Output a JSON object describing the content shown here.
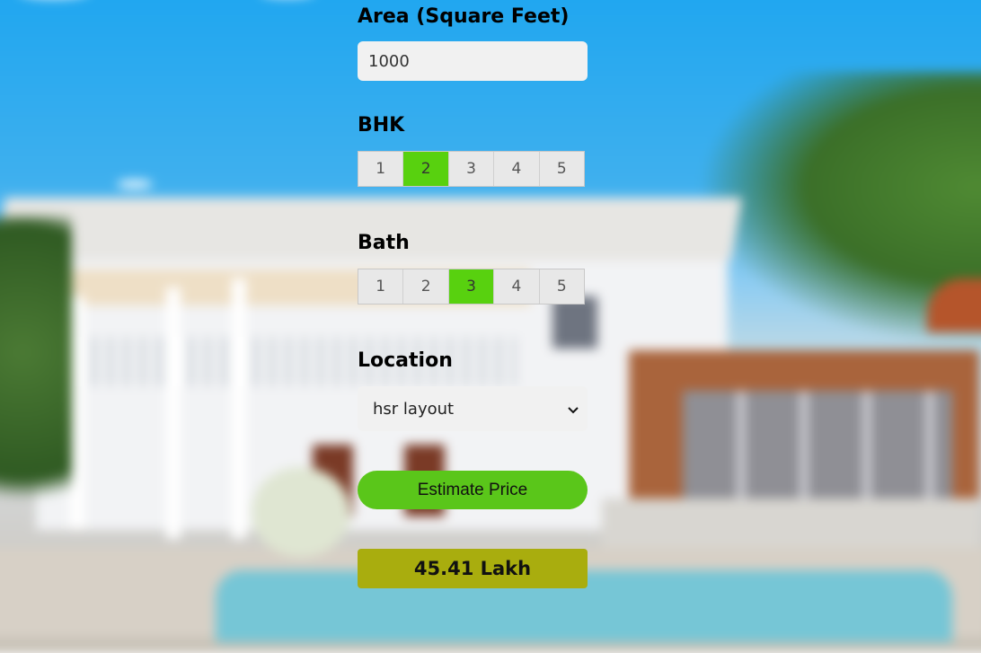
{
  "area": {
    "label": "Area (Square Feet)",
    "value": "1000"
  },
  "bhk": {
    "label": "BHK",
    "options": [
      "1",
      "2",
      "3",
      "4",
      "5"
    ],
    "selected": "2"
  },
  "bath": {
    "label": "Bath",
    "options": [
      "1",
      "2",
      "3",
      "4",
      "5"
    ],
    "selected": "3"
  },
  "location": {
    "label": "Location",
    "selected": "hsr layout",
    "icon": "chevron-down-icon"
  },
  "estimate_button": {
    "label": "Estimate Price"
  },
  "result": {
    "text": "45.41 Lakh"
  },
  "colors": {
    "selected": "#58d10f",
    "button": "#5ac61a",
    "result": "#a9ad0e"
  }
}
